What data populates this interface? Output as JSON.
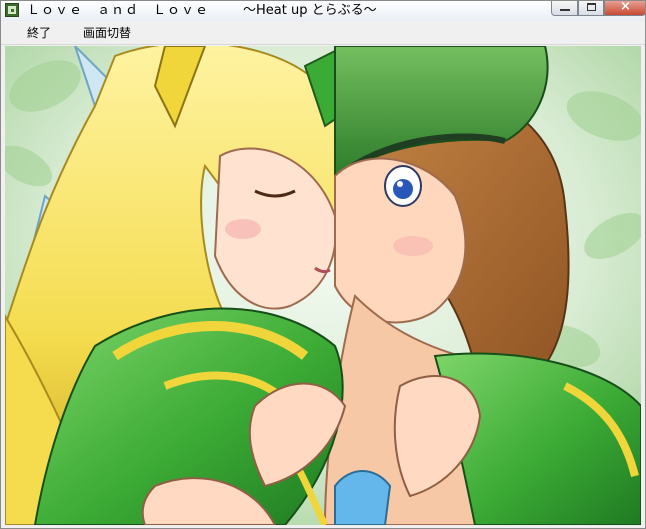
{
  "window": {
    "title": "Ｌｏｖｅ　ａｎｄ　Ｌｏｖｅ",
    "title_suffix": "～Heat up とらぶる～"
  },
  "menu": {
    "items": [
      {
        "label": "終了"
      },
      {
        "label": "画面切替"
      }
    ]
  },
  "colors": {
    "titlebar": "#e9eef5",
    "menubar": "#f0f0f0",
    "close_button": "#c74a34",
    "armor_green": "#3cab35",
    "armor_gold": "#f0d63b",
    "hair_blonde": "#f4dc4e",
    "hair_brown": "#ad6a2e",
    "cap_green": "#4d9f3f",
    "background_leaf_green": "#9ecf91"
  },
  "icons": [
    "app-icon",
    "minimize-icon",
    "maximize-icon",
    "close-icon"
  ]
}
